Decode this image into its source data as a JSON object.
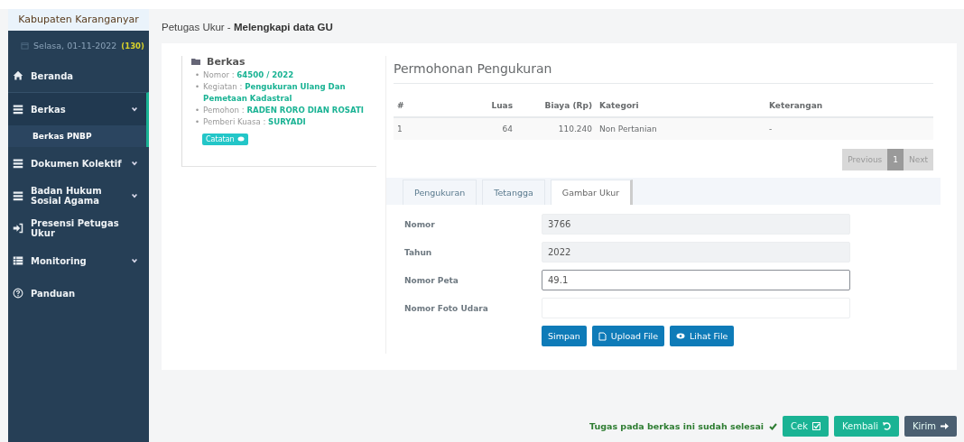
{
  "sidebar": {
    "region": "Kabupaten Karanganyar",
    "date": "Selasa, 01-11-2022",
    "count": "(130)",
    "items": [
      {
        "label": "Beranda",
        "collapsible": false,
        "expanded": false
      },
      {
        "label": "Berkas",
        "collapsible": true,
        "expanded": true,
        "children": [
          {
            "label": "Berkas PNBP",
            "selected": true
          }
        ]
      },
      {
        "label": "Dokumen Kolektif",
        "collapsible": true,
        "expanded": false
      },
      {
        "label": "Badan Hukum Sosial Agama",
        "collapsible": true,
        "expanded": false
      },
      {
        "label": "Presensi Petugas Ukur",
        "collapsible": false,
        "expanded": false
      },
      {
        "label": "Monitoring",
        "collapsible": true,
        "expanded": false
      },
      {
        "label": "Panduan",
        "collapsible": false,
        "expanded": false
      }
    ]
  },
  "page_title": {
    "prefix": "Petugas Ukur - ",
    "title": "Melengkapi data GU"
  },
  "berkas": {
    "title": "Berkas",
    "fields": [
      {
        "bullet": "•",
        "label": "Nomor : ",
        "value": "64500 / 2022"
      },
      {
        "bullet": "•",
        "label": "Kegiatan : ",
        "value": "Pengukuran Ulang Dan Pemetaan Kadastral"
      },
      {
        "bullet": "•",
        "label": "Pemohon : ",
        "value": "RADEN RORO DIAN ROSATI"
      },
      {
        "bullet": "•",
        "label": "Pemberi Kuasa : ",
        "value": "SURYADI"
      }
    ],
    "note_button": "Catatan"
  },
  "permohonan": {
    "title": "Permohonan Pengukuran",
    "columns": [
      "#",
      "Luas",
      "Biaya (Rp)",
      "Kategori",
      "Keterangan"
    ],
    "rows": [
      [
        "1",
        "64",
        "110.240",
        "Non Pertanian",
        "-"
      ]
    ],
    "pagination": [
      {
        "label": "Previous",
        "selected": false
      },
      {
        "label": "1",
        "selected": true
      },
      {
        "label": "Next",
        "selected": false
      }
    ]
  },
  "tabs": [
    {
      "label": "Pengukuran",
      "selected": false
    },
    {
      "label": "Tetangga",
      "selected": false
    },
    {
      "label": "Gambar Ukur",
      "selected": true
    }
  ],
  "form": [
    {
      "label": "Nomor",
      "value": "3766",
      "readonly": true,
      "focused": false
    },
    {
      "label": "Tahun",
      "value": "2022",
      "readonly": true,
      "focused": false
    },
    {
      "label": "Nomor Peta",
      "value": "49.1",
      "readonly": false,
      "focused": true
    },
    {
      "label": "Nomor Foto Udara",
      "readonly": false,
      "focused": false
    }
  ],
  "form_buttons": [
    "Simpan",
    "Upload File",
    "Lihat File"
  ],
  "footer": {
    "status": "Tugas pada berkas ini sudah selesai",
    "buttons": [
      "Cek",
      "Kembali",
      "Kirim"
    ]
  }
}
